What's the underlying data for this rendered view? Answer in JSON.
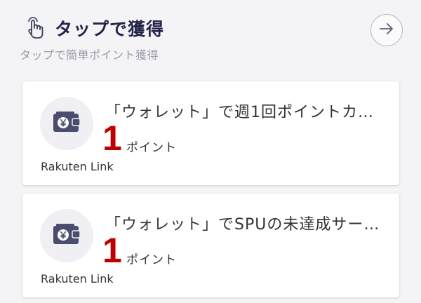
{
  "header": {
    "title": "タップで獲得",
    "subtitle": "タップで簡単ポイント獲得",
    "arrow_icon": "arrow-right-icon",
    "tap_icon": "hand-pointer-icon"
  },
  "cards": [
    {
      "title": "「ウォレット」で週1回ポイントカ…",
      "points": "1",
      "points_unit": "ポイント",
      "app_name": "Rakuten Link",
      "icon": "wallet-yen-icon"
    },
    {
      "title": "「ウォレット」でSPUの未達成サー…",
      "points": "1",
      "points_unit": "ポイント",
      "app_name": "Rakuten Link",
      "icon": "wallet-yen-icon"
    }
  ],
  "colors": {
    "points": "#bf0000",
    "title": "#242548",
    "subtitle": "#9a9aac",
    "icon": "#4a4d6e"
  }
}
